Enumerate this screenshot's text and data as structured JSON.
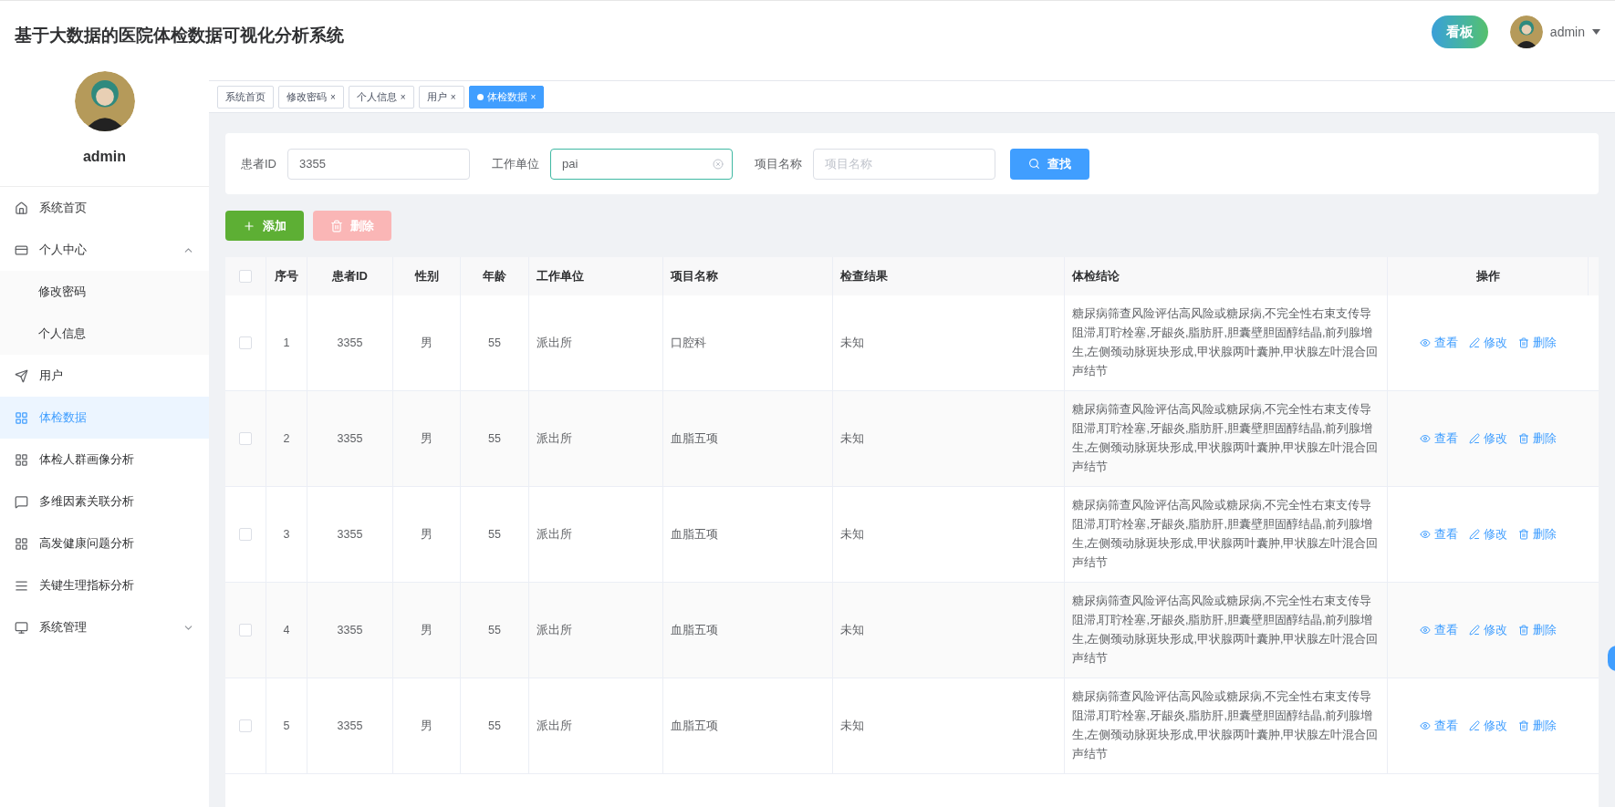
{
  "header": {
    "title": "基于大数据的医院体检数据可视化分析系统",
    "board_button": "看板",
    "user_name": "admin"
  },
  "sidebar": {
    "user_name": "admin",
    "menu": [
      {
        "label": "系统首页",
        "kind": "home",
        "selected": false
      },
      {
        "label": "个人中心",
        "kind": "card",
        "selected": false,
        "expanded": true,
        "children": [
          {
            "label": "修改密码",
            "selected": false
          },
          {
            "label": "个人信息",
            "selected": false
          }
        ]
      },
      {
        "label": "用户",
        "kind": "send",
        "selected": false
      },
      {
        "label": "体检数据",
        "kind": "grid",
        "selected": true
      },
      {
        "label": "体检人群画像分析",
        "kind": "grid",
        "selected": false
      },
      {
        "label": "多维因素关联分析",
        "kind": "chat",
        "selected": false
      },
      {
        "label": "高发健康问题分析",
        "kind": "grid",
        "selected": false
      },
      {
        "label": "关键生理指标分析",
        "kind": "list",
        "selected": false
      },
      {
        "label": "系统管理",
        "kind": "monitor",
        "selected": false,
        "expanded": false
      }
    ]
  },
  "tabs": [
    {
      "label": "系统首页",
      "selected": false
    },
    {
      "label": "修改密码",
      "selected": false,
      "close": "×"
    },
    {
      "label": "个人信息",
      "selected": false,
      "close": "×"
    },
    {
      "label": "用户",
      "selected": false,
      "close": "×"
    },
    {
      "label": "体检数据",
      "selected": true,
      "close": "×"
    }
  ],
  "search": {
    "fields": [
      {
        "label": "患者ID",
        "value": "3355",
        "focused": false
      },
      {
        "label": "工作单位",
        "value": "pai",
        "focused": true
      },
      {
        "label": "项目名称",
        "placeholder": "项目名称",
        "focused": false
      }
    ],
    "button": "查找"
  },
  "actions": [
    {
      "label": "添加",
      "kind": "add",
      "disabled": false
    },
    {
      "label": "删除",
      "kind": "delete",
      "disabled": true
    }
  ],
  "table": {
    "all_checked": false,
    "columns": [
      "序号",
      "患者ID",
      "性别",
      "年龄",
      "工作单位",
      "项目名称",
      "检查结果",
      "体检结论",
      "操作"
    ],
    "rows": [
      {
        "checked": false,
        "cells": [
          "1",
          "3355",
          "男",
          "55",
          "派出所",
          "口腔科",
          "未知",
          "糖尿病筛查风险评估高风险或糖尿病,不完全性右束支传导阻滞,耵聍栓塞,牙龈炎,脂肪肝,胆囊壁胆固醇结晶,前列腺增生,左侧颈动脉斑块形成,甲状腺两叶囊肿,甲状腺左叶混合回声结节"
        ],
        "actions": [
          "查看",
          "修改",
          "删除"
        ]
      },
      {
        "checked": false,
        "cells": [
          "2",
          "3355",
          "男",
          "55",
          "派出所",
          "血脂五项",
          "未知",
          "糖尿病筛查风险评估高风险或糖尿病,不完全性右束支传导阻滞,耵聍栓塞,牙龈炎,脂肪肝,胆囊壁胆固醇结晶,前列腺增生,左侧颈动脉斑块形成,甲状腺两叶囊肿,甲状腺左叶混合回声结节"
        ],
        "actions": [
          "查看",
          "修改",
          "删除"
        ]
      },
      {
        "checked": false,
        "cells": [
          "3",
          "3355",
          "男",
          "55",
          "派出所",
          "血脂五项",
          "未知",
          "糖尿病筛查风险评估高风险或糖尿病,不完全性右束支传导阻滞,耵聍栓塞,牙龈炎,脂肪肝,胆囊壁胆固醇结晶,前列腺增生,左侧颈动脉斑块形成,甲状腺两叶囊肿,甲状腺左叶混合回声结节"
        ],
        "actions": [
          "查看",
          "修改",
          "删除"
        ]
      },
      {
        "checked": false,
        "cells": [
          "4",
          "3355",
          "男",
          "55",
          "派出所",
          "血脂五项",
          "未知",
          "糖尿病筛查风险评估高风险或糖尿病,不完全性右束支传导阻滞,耵聍栓塞,牙龈炎,脂肪肝,胆囊壁胆固醇结晶,前列腺增生,左侧颈动脉斑块形成,甲状腺两叶囊肿,甲状腺左叶混合回声结节"
        ],
        "actions": [
          "查看",
          "修改",
          "删除"
        ]
      },
      {
        "checked": false,
        "cells": [
          "5",
          "3355",
          "男",
          "55",
          "派出所",
          "血脂五项",
          "未知",
          "糖尿病筛查风险评估高风险或糖尿病,不完全性右束支传导阻滞,耵聍栓塞,牙龈炎,脂肪肝,胆囊壁胆固醇结晶,前列腺增生,左侧颈动脉斑块形成,甲状腺两叶囊肿,甲状腺左叶混合回声结节"
        ],
        "actions": [
          "查看",
          "修改",
          "删除"
        ]
      }
    ]
  }
}
